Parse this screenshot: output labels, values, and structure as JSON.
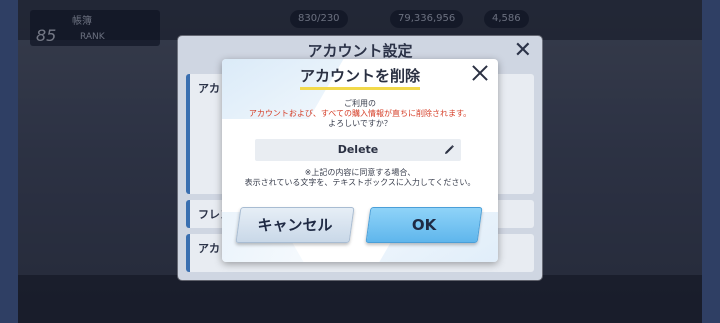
{
  "hud": {
    "level": "85",
    "rank_label": "RANK",
    "player_name": "帳簿",
    "resource_1": "830/230",
    "resource_2": "79,336,956",
    "resource_3": "4,586"
  },
  "settings_panel": {
    "title": "アカウント設定",
    "rows": [
      {
        "label": "アカ"
      },
      {
        "label": "フレン"
      },
      {
        "label": "アカ"
      }
    ]
  },
  "dialog": {
    "title": "アカウントを削除",
    "message_line1": "ご利用の",
    "message_line2": "アカウントおよび、すべての購入情報が直ちに削除されます。",
    "message_line3": "よろしいですか？",
    "input_value": "Delete",
    "note_line1": "※上記の内容に同意する場合、",
    "note_line2": "表示されている文字を、テキストボックスに入力してください。",
    "cancel_label": "キャンセル",
    "ok_label": "OK"
  },
  "colors": {
    "accent_blue": "#5fb6ec",
    "warning_red": "#d6402a",
    "title_underline": "#f2d94a"
  }
}
